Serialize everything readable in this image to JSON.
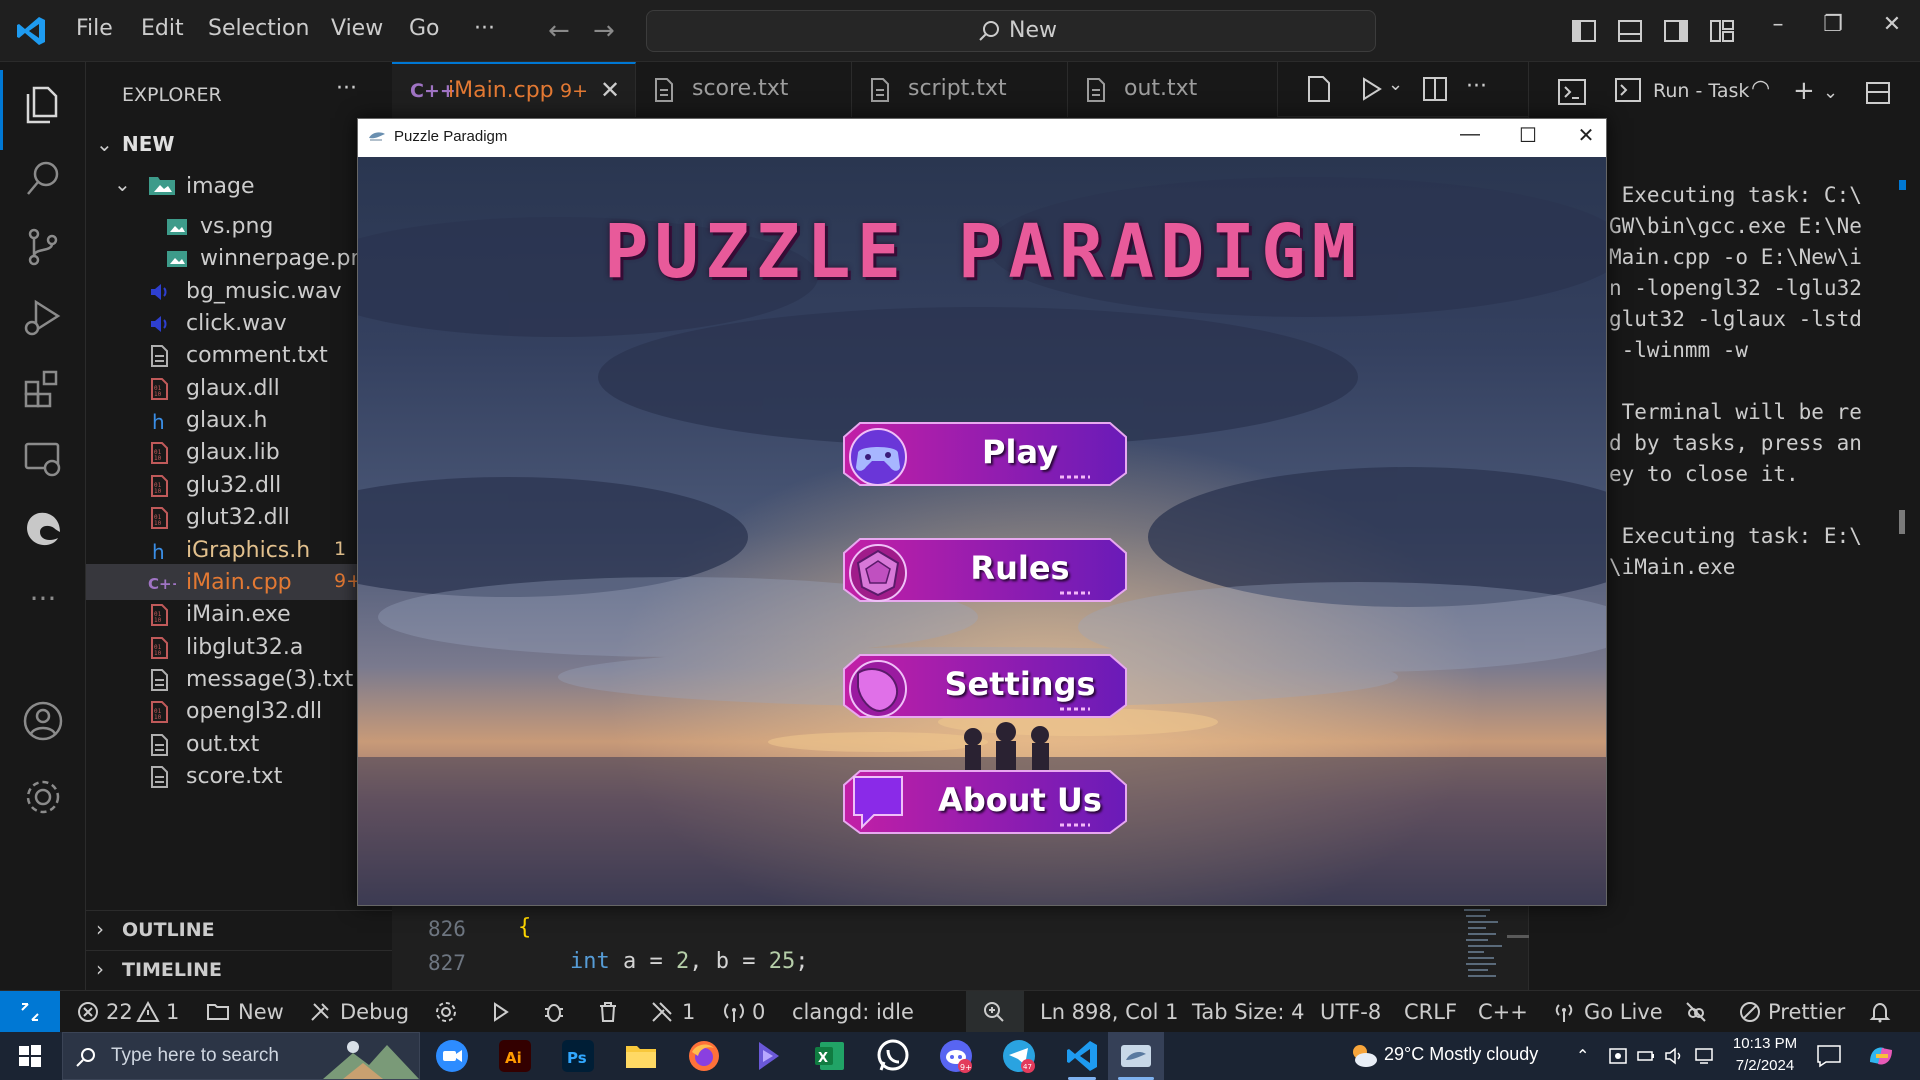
{
  "menu": {
    "file": "File",
    "edit": "Edit",
    "selection": "Selection",
    "view": "View",
    "go": "Go",
    "more": "···"
  },
  "command_center": {
    "label": "New",
    "icon": "search-icon"
  },
  "window_controls": {
    "minimize": "–",
    "restore": "❐",
    "close": "✕"
  },
  "sidebar": {
    "title": "EXPLORER",
    "more": "···",
    "root_folder": "NEW",
    "subfolder": "image",
    "files": [
      {
        "label": "vs.png",
        "icon": "image-file-icon"
      },
      {
        "label": "winnerpage.png",
        "icon": "image-file-icon"
      },
      {
        "label": "bg_music.wav",
        "icon": "audio-file-icon"
      },
      {
        "label": "click.wav",
        "icon": "audio-file-icon"
      },
      {
        "label": "comment.txt",
        "icon": "text-file-icon"
      },
      {
        "label": "glaux.dll",
        "icon": "binary-file-icon"
      },
      {
        "label": "glaux.h",
        "icon": "header-file-icon"
      },
      {
        "label": "glaux.lib",
        "icon": "binary-file-icon"
      },
      {
        "label": "glu32.dll",
        "icon": "binary-file-icon"
      },
      {
        "label": "glut32.dll",
        "icon": "binary-file-icon"
      },
      {
        "label": "iGraphics.h",
        "icon": "header-file-icon",
        "badge": "1"
      },
      {
        "label": "iMain.cpp",
        "icon": "cpp-file-icon",
        "badge": "9+",
        "selected": true
      },
      {
        "label": "iMain.exe",
        "icon": "binary-file-icon"
      },
      {
        "label": "libglut32.a",
        "icon": "binary-file-icon"
      },
      {
        "label": "message(3).txt",
        "icon": "text-file-icon"
      },
      {
        "label": "opengl32.dll",
        "icon": "binary-file-icon"
      },
      {
        "label": "out.txt",
        "icon": "text-file-icon"
      },
      {
        "label": "score.txt",
        "icon": "text-file-icon"
      }
    ],
    "outline": "OUTLINE",
    "timeline": "TIMELINE"
  },
  "tabs": [
    {
      "label": "iMain.cpp",
      "icon": "C++",
      "badge": "9+",
      "close": "✕",
      "active": true
    },
    {
      "label": "score.txt",
      "icon": "text-file-icon"
    },
    {
      "label": "script.txt",
      "icon": "text-file-icon"
    },
    {
      "label": "out.txt",
      "icon": "text-file-icon"
    }
  ],
  "terminal": {
    "task_label": "Run - Task",
    "add": "+",
    "output": " Executing task: C:\\\nGW\\bin\\gcc.exe E:\\Ne\nMain.cpp -o E:\\New\\i\nn -lopengl32 -lglu32\nglut32 -lglaux -lstd\n -lwinmm -w\n\n Terminal will be re\nd by tasks, press an\ney to close it.\n\n Executing task: E:\\\n\\iMain.exe"
  },
  "code": {
    "lines": [
      {
        "no": "826",
        "brace": "{"
      },
      {
        "no": "827",
        "kw": "int",
        "rest_a": " a = ",
        "num_a": "2",
        "rest_b": ", b = ",
        "num_b": "25",
        "end": ";"
      }
    ]
  },
  "game": {
    "window_title": "Puzzle Paradigm",
    "controls": {
      "minimize": "—",
      "maximize": "☐",
      "close": "✕"
    },
    "logo": "PUZZLE PARADIGM",
    "buttons": [
      {
        "label": "Play",
        "icon": "gamepad-icon"
      },
      {
        "label": "Rules",
        "icon": "dice-icon"
      },
      {
        "label": "Settings",
        "icon": "pointer-hand-icon"
      },
      {
        "label": "About Us",
        "icon": "chat-bubble-icon"
      }
    ],
    "colors": {
      "button_gradient_start": "#c21fa6",
      "button_gradient_end": "#6a1bb8",
      "logo": "#e85a9a"
    }
  },
  "statusbar": {
    "errors": "22",
    "warnings": "1",
    "new_label": "New",
    "debug_label": "Debug",
    "tools_count": "1",
    "ports_count": "0",
    "clangd": "clangd: idle",
    "cursor": "Ln 898, Col 1",
    "tab_size": "Tab Size: 4",
    "encoding": "UTF-8",
    "eol": "CRLF",
    "language": "C++",
    "go_live": "Go Live",
    "prettier": "Prettier"
  },
  "taskbar": {
    "search_placeholder": "Type here to search",
    "apps": [
      "zoom",
      "Ai",
      "Ps",
      "file-explorer",
      "firefox",
      "media-player",
      "excel",
      "whatsapp",
      "discord",
      "telegram",
      "vscode",
      "igraphics-app"
    ],
    "badges": {
      "discord": "9+",
      "telegram": "47"
    },
    "weather": "29°C  Mostly cloudy",
    "time": "10:13 PM",
    "date": "7/2/2024"
  },
  "accent_colors": {
    "vscode_blue": "#0078d4",
    "tab_modified": "#e37933"
  }
}
